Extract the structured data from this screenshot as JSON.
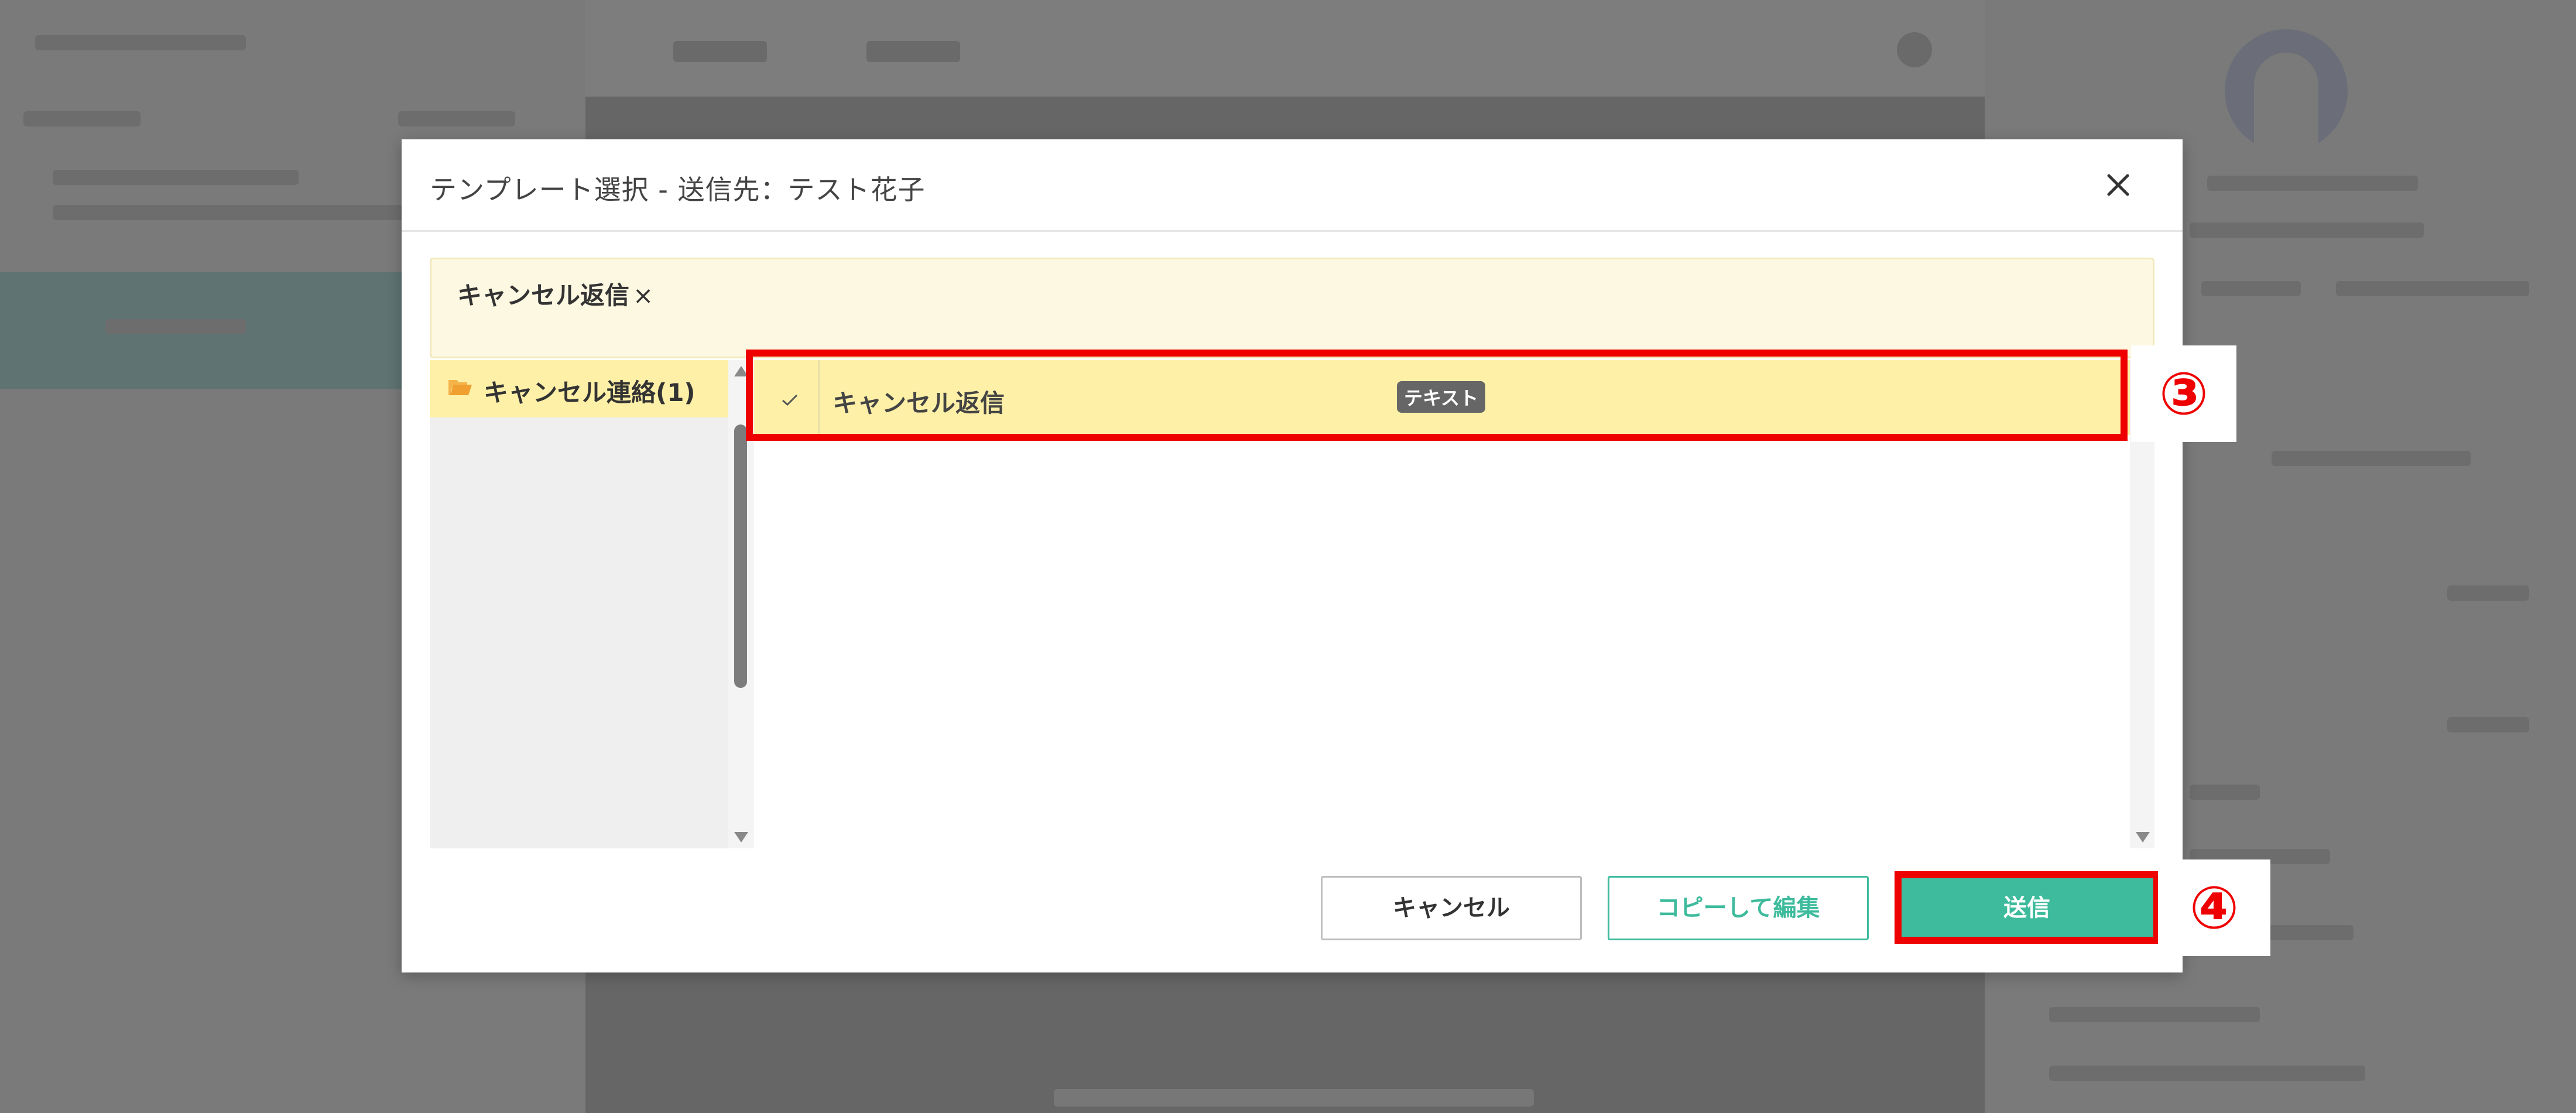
{
  "modal": {
    "title": "テンプレート選択 - 送信先：テスト花子",
    "close_icon": "close-icon",
    "selected_tag": {
      "label": "キャンセル返信",
      "remove": "×"
    },
    "folders": [
      {
        "label": "キャンセル連絡(1)",
        "icon": "folder-open-icon",
        "selected": true
      }
    ],
    "templates": [
      {
        "name": "キャンセル返信",
        "type": "テキスト",
        "selected": true,
        "icon": "check-icon"
      }
    ],
    "buttons": {
      "cancel": "キャンセル",
      "copy_edit": "コピーして編集",
      "send": "送信"
    }
  },
  "annotations": {
    "step3": "③",
    "step4": "④",
    "color": "#ee0000"
  },
  "colors": {
    "accent": "#3dbb9c",
    "selected_bg": "#fff0a8",
    "tag_box_bg": "#fdf8e1",
    "badge_bg": "#666666"
  }
}
